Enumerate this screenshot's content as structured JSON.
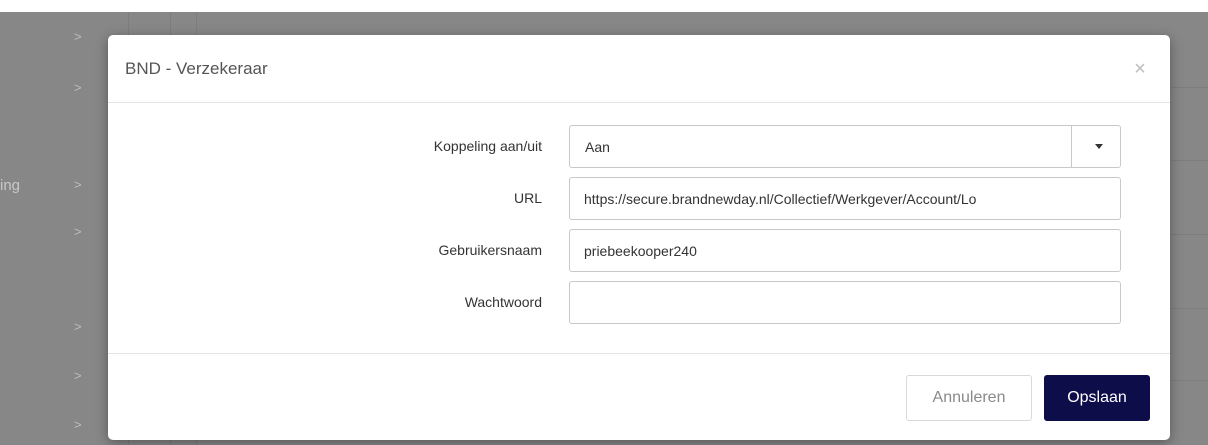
{
  "background": {
    "partial_label": "ing",
    "chevron_glyph": ">"
  },
  "modal": {
    "title": "BND - Verzekeraar",
    "close_glyph": "×",
    "fields": {
      "koppeling": {
        "label": "Koppeling aan/uit",
        "value": "Aan"
      },
      "url": {
        "label": "URL",
        "value": "https://secure.brandnewday.nl/Collectief/Werkgever/Account/Lo"
      },
      "gebruikersnaam": {
        "label": "Gebruikersnaam",
        "value": "priebeekooper240"
      },
      "wachtwoord": {
        "label": "Wachtwoord",
        "value": ""
      }
    },
    "buttons": {
      "cancel": "Annuleren",
      "save": "Opslaan"
    }
  },
  "colors": {
    "primary_button": "#0d0d4a",
    "overlay": "#878787"
  },
  "icons": {
    "close": "close-icon",
    "dropdown": "caret-down-icon",
    "row_expand": "chevron-right-icon"
  }
}
